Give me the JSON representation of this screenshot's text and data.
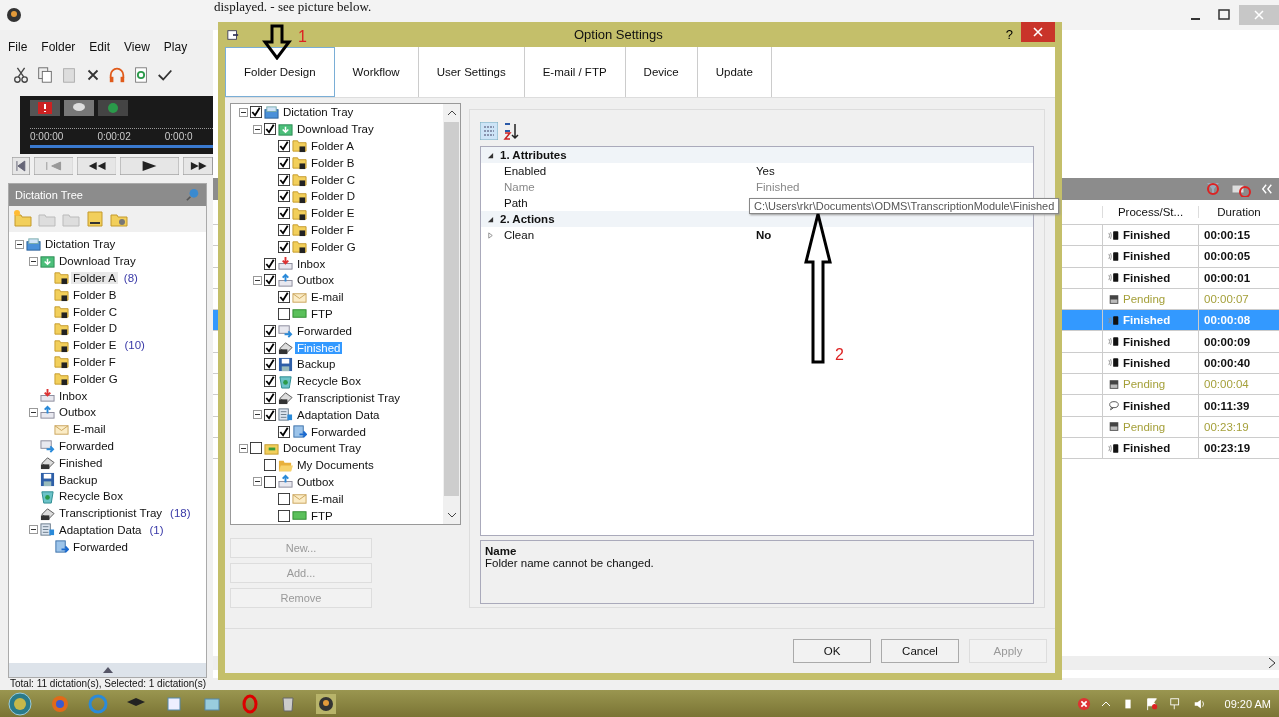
{
  "caption_fragment": "displayed. - see picture below.",
  "menu": [
    "File",
    "Folder",
    "Edit",
    "View",
    "Play"
  ],
  "player": {
    "time_marks": [
      "0:00:00",
      "0:00:02",
      "0:00:0"
    ]
  },
  "dictation_tree": {
    "title": "Dictation Tree",
    "items": [
      {
        "label": "Dictation Tray",
        "kind": "tray",
        "expanded": true,
        "selected": false,
        "children": [
          {
            "label": "Download Tray",
            "kind": "download",
            "expanded": true,
            "selected": false,
            "children": [
              {
                "label": "Folder A",
                "kind": "folder",
                "count": "(8)",
                "selected": true
              },
              {
                "label": "Folder B",
                "kind": "folder",
                "selected": false
              },
              {
                "label": "Folder C",
                "kind": "folder",
                "selected": false
              },
              {
                "label": "Folder D",
                "kind": "folder",
                "selected": false
              },
              {
                "label": "Folder E",
                "kind": "folder",
                "count": "(10)",
                "selected": false
              },
              {
                "label": "Folder F",
                "kind": "folder",
                "selected": false
              },
              {
                "label": "Folder G",
                "kind": "folder",
                "selected": false
              }
            ]
          },
          {
            "label": "Inbox",
            "kind": "inbox",
            "selected": false
          },
          {
            "label": "Outbox",
            "kind": "outbox",
            "expanded": true,
            "selected": false,
            "children": [
              {
                "label": "E-mail",
                "kind": "email",
                "selected": false
              }
            ]
          },
          {
            "label": "Forwarded",
            "kind": "forwarded",
            "selected": false
          },
          {
            "label": "Finished",
            "kind": "finished",
            "selected": false
          },
          {
            "label": "Backup",
            "kind": "backup",
            "selected": false
          },
          {
            "label": "Recycle Box",
            "kind": "recycle",
            "selected": false
          },
          {
            "label": "Transcriptionist Tray",
            "kind": "transcriptionist",
            "count": "(18)",
            "selected": false
          },
          {
            "label": "Adaptation Data",
            "kind": "adaptation",
            "count": "(1)",
            "expanded": true,
            "selected": false,
            "children": [
              {
                "label": "Forwarded",
                "kind": "forwarded_data",
                "selected": false
              }
            ]
          }
        ]
      }
    ]
  },
  "list": {
    "columns": [
      "Process/St...",
      "Duration"
    ],
    "rows": [
      {
        "kind": "device",
        "status": "Finished",
        "duration": "00:00:15",
        "selected": false
      },
      {
        "kind": "device",
        "status": "Finished",
        "duration": "00:00:05",
        "selected": false
      },
      {
        "kind": "device",
        "status": "Finished",
        "duration": "00:00:01",
        "selected": false
      },
      {
        "kind": "pending",
        "status": "Pending",
        "duration": "00:00:07",
        "selected": false
      },
      {
        "kind": "device",
        "status": "Finished",
        "duration": "00:00:08",
        "selected": true
      },
      {
        "kind": "device",
        "status": "Finished",
        "duration": "00:00:09",
        "selected": false
      },
      {
        "kind": "device",
        "status": "Finished",
        "duration": "00:00:40",
        "selected": false
      },
      {
        "kind": "pending",
        "status": "Pending",
        "duration": "00:00:04",
        "selected": false
      },
      {
        "kind": "comment",
        "status": "Finished",
        "duration": "00:11:39",
        "selected": false
      },
      {
        "kind": "pending",
        "status": "Pending",
        "duration": "00:23:19",
        "selected": false
      },
      {
        "kind": "device",
        "status": "Finished",
        "duration": "00:23:19",
        "selected": false
      }
    ]
  },
  "status_bar": "Total: 11 dictation(s), Selected: 1 dictation(s)",
  "taskbar": {
    "clock": "09:20 AM"
  },
  "dialog": {
    "title": "Option Settings",
    "help": "?",
    "tabs": [
      {
        "label": "Folder Design",
        "selected": true
      },
      {
        "label": "Workflow",
        "selected": false
      },
      {
        "label": "User Settings",
        "selected": false
      },
      {
        "label": "E-mail / FTP",
        "selected": false
      },
      {
        "label": "Device",
        "selected": false
      },
      {
        "label": "Update",
        "selected": false
      }
    ],
    "tree": [
      {
        "label": "Dictation Tray",
        "kind": "tray",
        "checked": true,
        "expanded": true,
        "selected": false,
        "children": [
          {
            "label": "Download Tray",
            "kind": "download",
            "checked": true,
            "expanded": true,
            "selected": false,
            "children": [
              {
                "label": "Folder A",
                "kind": "folder",
                "checked": true,
                "selected": false
              },
              {
                "label": "Folder B",
                "kind": "folder",
                "checked": true,
                "selected": false
              },
              {
                "label": "Folder C",
                "kind": "folder",
                "checked": true,
                "selected": false
              },
              {
                "label": "Folder D",
                "kind": "folder",
                "checked": true,
                "selected": false
              },
              {
                "label": "Folder E",
                "kind": "folder",
                "checked": true,
                "selected": false
              },
              {
                "label": "Folder F",
                "kind": "folder",
                "checked": true,
                "selected": false
              },
              {
                "label": "Folder G",
                "kind": "folder",
                "checked": true,
                "selected": false
              }
            ]
          },
          {
            "label": "Inbox",
            "kind": "inbox",
            "checked": true,
            "selected": false
          },
          {
            "label": "Outbox",
            "kind": "outbox",
            "checked": true,
            "expanded": true,
            "selected": false,
            "children": [
              {
                "label": "E-mail",
                "kind": "email",
                "checked": true,
                "selected": false
              },
              {
                "label": "FTP",
                "kind": "ftp",
                "checked": false,
                "selected": false
              }
            ]
          },
          {
            "label": "Forwarded",
            "kind": "forwarded",
            "checked": true,
            "selected": false
          },
          {
            "label": "Finished",
            "kind": "finished",
            "checked": true,
            "selected": true
          },
          {
            "label": "Backup",
            "kind": "backup",
            "checked": true,
            "selected": false
          },
          {
            "label": "Recycle Box",
            "kind": "recycle",
            "checked": true,
            "selected": false
          },
          {
            "label": "Transcriptionist Tray",
            "kind": "transcriptionist",
            "checked": true,
            "selected": false
          },
          {
            "label": "Adaptation Data",
            "kind": "adaptation",
            "checked": true,
            "expanded": true,
            "selected": false,
            "children": [
              {
                "label": "Forwarded",
                "kind": "forwarded_data",
                "checked": true,
                "selected": false
              }
            ]
          }
        ]
      },
      {
        "label": "Document Tray",
        "kind": "document",
        "checked": false,
        "expanded": true,
        "selected": false,
        "children": [
          {
            "label": "My Documents",
            "kind": "mydocs",
            "checked": false,
            "selected": false
          },
          {
            "label": "Outbox",
            "kind": "outbox",
            "checked": false,
            "expanded": true,
            "selected": false,
            "children": [
              {
                "label": "E-mail",
                "kind": "email",
                "checked": false,
                "selected": false
              },
              {
                "label": "FTP",
                "kind": "ftp",
                "checked": false,
                "selected": false
              }
            ]
          }
        ]
      }
    ],
    "tree_buttons": [
      {
        "label": "New...",
        "disabled": true
      },
      {
        "label": "Add...",
        "disabled": true
      },
      {
        "label": "Remove",
        "disabled": true
      }
    ],
    "properties": [
      {
        "title": "1. Attributes",
        "expanded": true,
        "rows": [
          {
            "name": "Enabled",
            "value": "Yes",
            "readonly": false
          },
          {
            "name": "Name",
            "value": "Finished",
            "readonly": true
          },
          {
            "name": "Path",
            "readonly": false
          }
        ]
      },
      {
        "title": "2. Actions",
        "expanded": true,
        "rows": [
          {
            "name": "Clean",
            "value": "No",
            "readonly": false,
            "expanded": false
          }
        ]
      }
    ],
    "tooltip": "C:\\Users\\rkr\\Documents\\ODMS\\TranscriptionModule\\Finished",
    "description": {
      "title": "Name",
      "text": "Folder name cannot be changed."
    },
    "buttons": [
      {
        "label": "OK",
        "disabled": false
      },
      {
        "label": "Cancel",
        "disabled": false
      },
      {
        "label": "Apply",
        "disabled": true
      }
    ]
  },
  "annotations": [
    {
      "label": "1",
      "kind": "down_arrow"
    },
    {
      "label": "2",
      "kind": "up_arrow"
    }
  ]
}
